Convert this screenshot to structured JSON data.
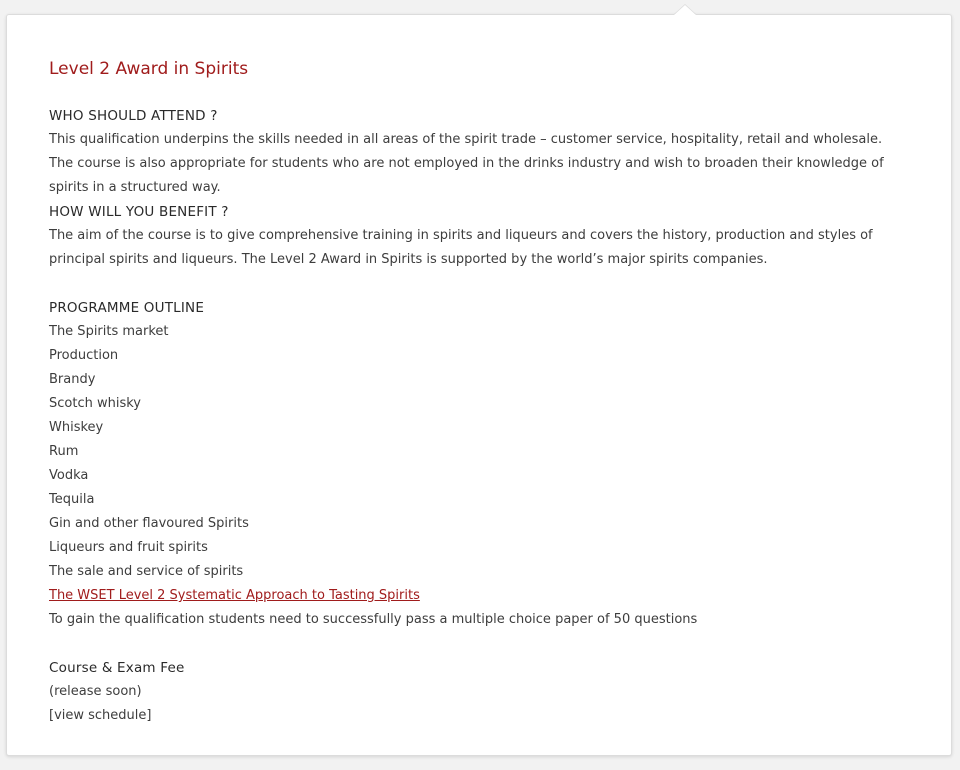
{
  "page": {
    "title": "Level 2 Award in Spirits"
  },
  "who": {
    "heading": "WHO SHOULD ATTEND ?",
    "text": "This qualification underpins the skills needed in all areas of the spirit trade – customer service, hospitality, retail and wholesale.  The course is also appropriate for students who are not employed in the drinks industry and wish to broaden their knowledge of spirits in a structured way."
  },
  "benefit": {
    "heading": "HOW WILL YOU BENEFIT ?",
    "text": "The aim of the course is to give comprehensive training in spirits and liqueurs and covers the history, production and styles of principal spirits and liqueurs.  The Level 2 Award in Spirits is supported by the world’s major spirits companies."
  },
  "outline": {
    "heading": "PROGRAMME OUTLINE",
    "items": [
      "The Spirits market",
      "Production",
      "Brandy",
      "Scotch whisky",
      "Whiskey",
      "Rum",
      "Vodka",
      "Tequila",
      "Gin and other flavoured Spirits",
      "Liqueurs and fruit spirits",
      "The sale and service of spirits"
    ],
    "link_text": "The WSET Level 2 Systematic Approach to Tasting Spirits ",
    "note": "To gain the qualification students need to successfully pass a multiple choice paper of 50 questions"
  },
  "fee": {
    "heading": "Course & Exam Fee",
    "status": "(release soon)",
    "schedule_link": "[view schedule]"
  },
  "colors": {
    "accent": "#a01c1c",
    "text": "#3d3d3d",
    "background": "#f2f2f2",
    "panel": "#ffffff"
  }
}
